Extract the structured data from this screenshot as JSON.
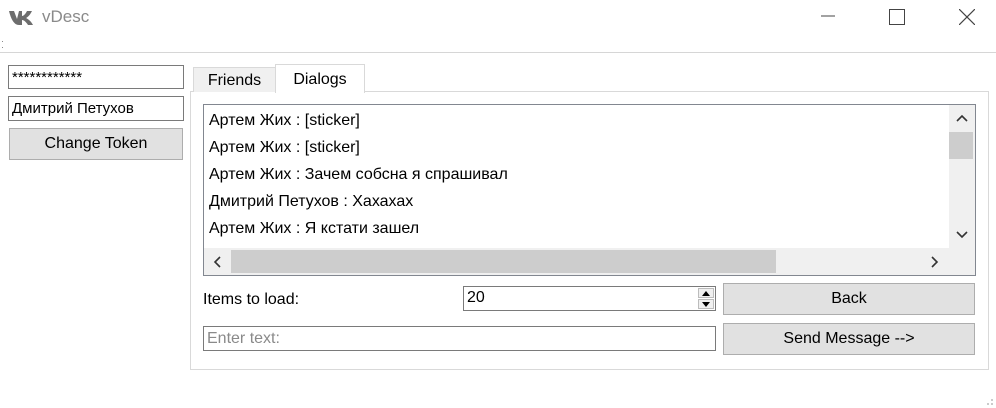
{
  "window": {
    "title": "vDesc",
    "logo_icon": "vk-logo-icon",
    "controls": [
      "minimize-icon",
      "maximize-icon",
      "close-icon"
    ]
  },
  "account": {
    "token_field": "************",
    "user_name": "Дмитрий Петухов",
    "change_token_label": "Change Token"
  },
  "tabs": [
    {
      "label": "Friends",
      "active": false
    },
    {
      "label": "Dialogs",
      "active": true
    }
  ],
  "dialog": {
    "messages": [
      "Артем Жих :  [sticker]",
      "Артем Жих :  [sticker]",
      "Артем Жих : Зачем собсна я спрашивал",
      "Дмитрий Петухов : Хахахах",
      "Артем Жих : Я кстати зашел"
    ],
    "items_to_load_label": "Items to load:",
    "items_to_load_value": "20",
    "back_label": "Back",
    "message_input_placeholder": "Enter text:",
    "send_label": "Send Message -->"
  },
  "colors": {
    "title_text": "#8a8a8a",
    "logo": "#6d6d6d",
    "button_face": "#e1e1e1",
    "scrollbar_track": "#f0f0f0",
    "scrollbar_thumb": "#cdcdcd"
  }
}
